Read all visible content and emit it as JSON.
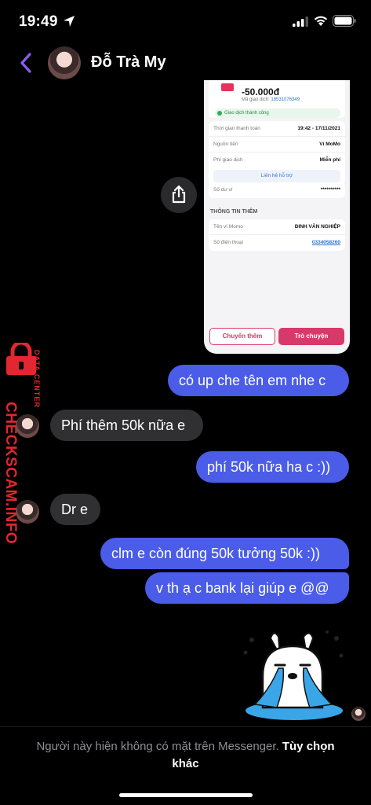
{
  "status_bar": {
    "time": "19:49"
  },
  "header": {
    "contact_name": "Đỗ Trà My"
  },
  "transaction": {
    "amount": "-50.000đ",
    "code_label": "Mã giao dịch:",
    "code": "18531076349",
    "status": "Giao dịch thành công",
    "rows": [
      {
        "label": "Thời gian thanh toán",
        "value": "19:42 - 17/11/2021"
      },
      {
        "label": "Nguồn tiền",
        "value": "Ví MoMo"
      },
      {
        "label": "Phí giao dịch",
        "value": "Miễn phí"
      }
    ],
    "help": "Liên hệ hỗ trợ",
    "balance_label": "Số dư ví",
    "balance_value": "**********",
    "section_title": "THÔNG TIN THÊM",
    "extra_rows": [
      {
        "label": "Tên ví Momo",
        "value": "ĐINH VĂN NGHIỆP"
      },
      {
        "label": "Số điện thoại",
        "value": "0334058260"
      }
    ],
    "btn_transfer": "Chuyển thêm",
    "btn_chat": "Trò chuyện"
  },
  "watermark": {
    "main": "CHECKSCAM.INFO",
    "sub": "DATA CENTER"
  },
  "messages": [
    {
      "dir": "out",
      "text": "có up che tên em nhe c"
    },
    {
      "dir": "in",
      "text": "Phí thêm 50k nữa e"
    },
    {
      "dir": "out",
      "text": "phí 50k nữa ha c :))"
    },
    {
      "dir": "in",
      "text": "Dr e"
    },
    {
      "dir": "out",
      "text": "clm e còn đúng 50k tưởng 50k :))"
    },
    {
      "dir": "out",
      "text": "v th ạ c bank lại giúp e @@"
    }
  ],
  "footer": {
    "notice": "Người này hiện không có mặt trên Messenger.",
    "link": "Tùy chọn khác"
  },
  "colors": {
    "accent": "#4a5ce8",
    "incoming": "#303033",
    "momo": "#d8396b",
    "watermark": "#e3262f"
  }
}
